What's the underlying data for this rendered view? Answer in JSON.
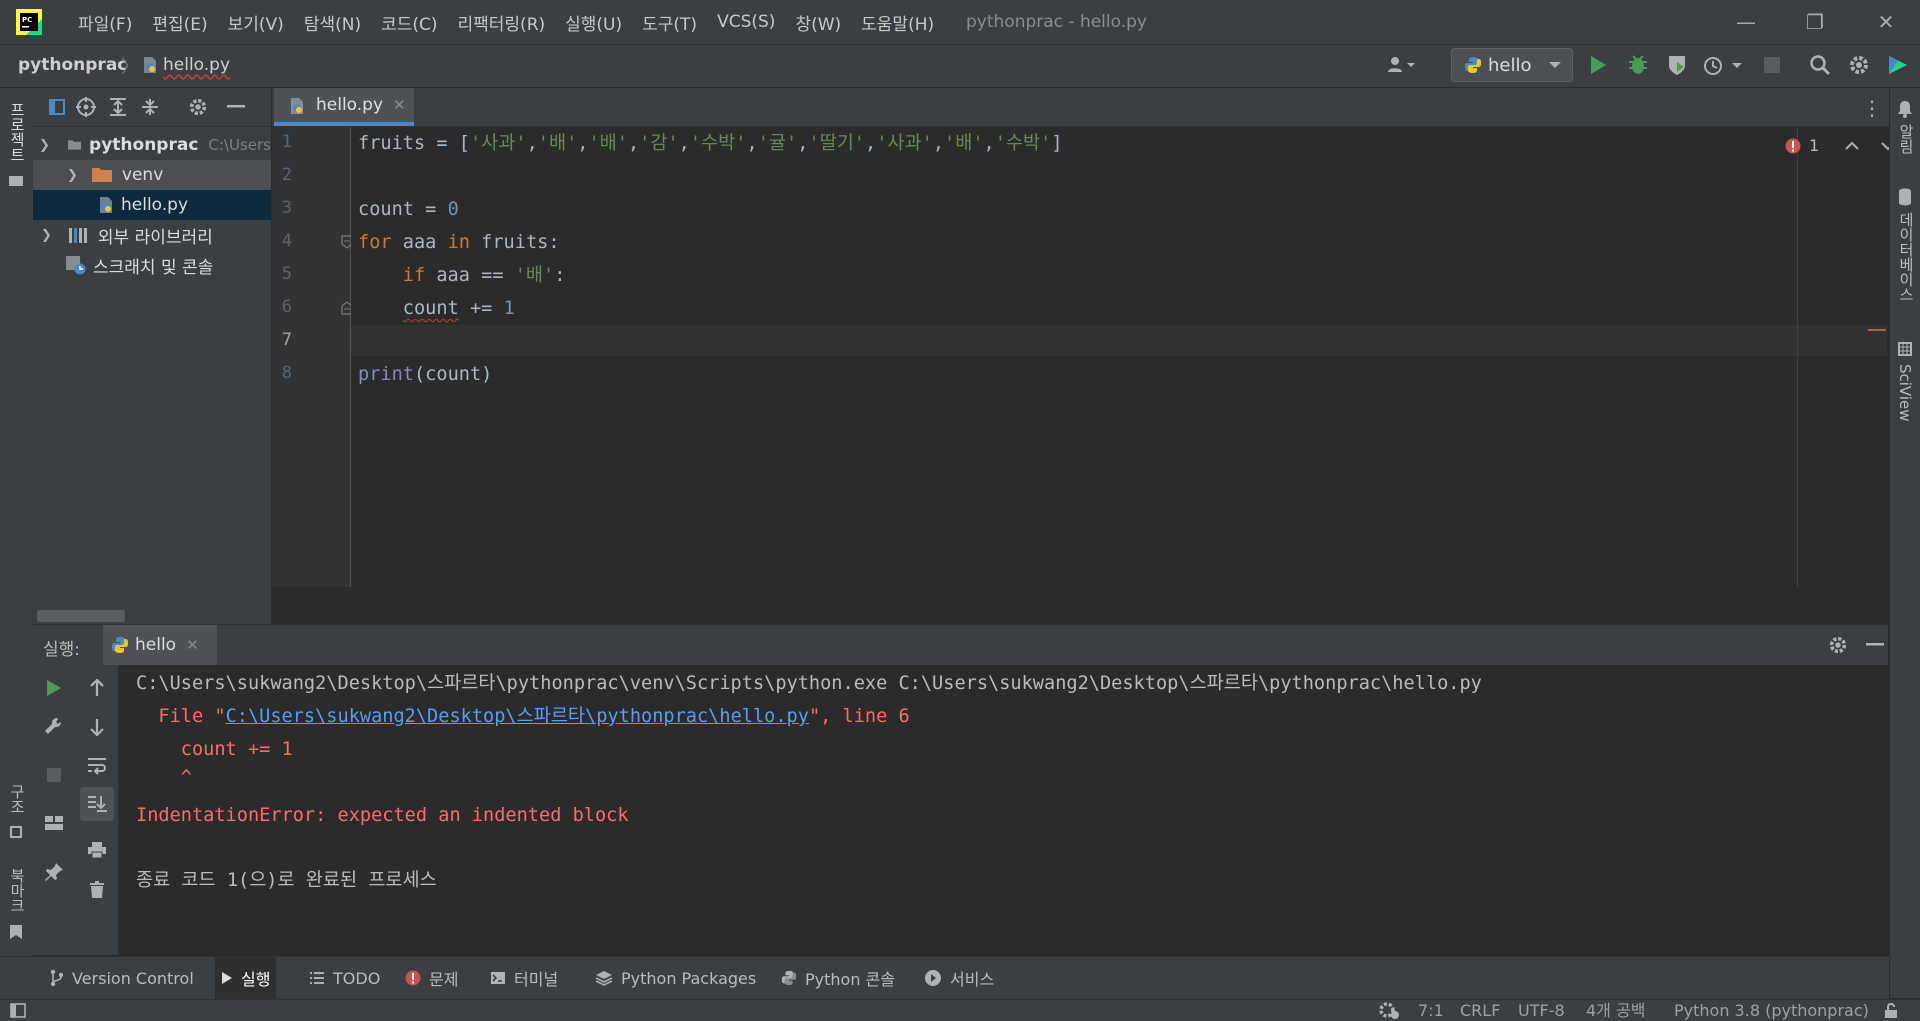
{
  "window": {
    "title": "pythonprac - hello.py",
    "minimize_symbol": "—",
    "restore_symbol": "❐",
    "close_symbol": "✕"
  },
  "menu": [
    "파일(F)",
    "편집(E)",
    "보기(V)",
    "탐색(N)",
    "코드(C)",
    "리팩터링(R)",
    "실행(U)",
    "도구(T)",
    "VCS(S)",
    "창(W)",
    "도움말(H)"
  ],
  "breadcrumb": {
    "project": "pythonprac",
    "file": "hello.py"
  },
  "run_config": {
    "label": "hello"
  },
  "left_stripe": {
    "project_label": "프로젝트",
    "structure_label": "구조",
    "bookmarks_label": "북마크"
  },
  "right_stripe": {
    "notifications_label": "알림",
    "database_label": "데이터베이스",
    "sciview_label": "SciView"
  },
  "project_tree": {
    "root": {
      "name": "pythonprac",
      "path": "C:\\Users"
    },
    "venv": "venv",
    "file": "hello.py",
    "external_libs": "외부 라이브러리",
    "scratches": "스크래치 및 콘솔"
  },
  "editor": {
    "tab": "hello.py",
    "line_numbers": [
      "1",
      "2",
      "3",
      "4",
      "5",
      "6",
      "7",
      "8"
    ],
    "problems_count": "1",
    "code": {
      "l1_var": "fruits",
      "l1_op": " = [",
      "l1_strings": [
        "'사과'",
        "'배'",
        "'배'",
        "'감'",
        "'수박'",
        "'귤'",
        "'딸기'",
        "'사과'",
        "'배'",
        "'수박'"
      ],
      "l1_close": "]",
      "l3_var": "count",
      "l3_op": " = ",
      "l3_num": "0",
      "l4_kw1": "for",
      "l4_mid": " aaa ",
      "l4_kw2": "in",
      "l4_end": " fruits:",
      "l5_indent": "    ",
      "l5_kw": "if",
      "l5_mid": " aaa == ",
      "l5_str": "'배'",
      "l5_end": ":",
      "l6_indent": "    ",
      "l6_var": "count",
      "l6_op": " += ",
      "l6_num": "1",
      "l8_fn": "print",
      "l8_args": "(count)"
    }
  },
  "run_panel": {
    "title": "실행:",
    "tab": "hello",
    "console": {
      "command": "C:\\Users\\sukwang2\\Desktop\\스파르타\\pythonprac\\venv\\Scripts\\python.exe C:\\Users\\sukwang2\\Desktop\\스파르타\\pythonprac\\hello.py",
      "file_prefix": "  File \"",
      "file_link": "C:\\Users\\sukwang2\\Desktop\\스파르타\\pythonprac\\hello.py",
      "file_suffix": "\", line 6",
      "code_line": "    count += 1",
      "caret_line": "    ^",
      "error": "IndentationError: expected an indented block",
      "exit": "종료 코드 1(으)로 완료된 프로세스"
    }
  },
  "bottom_tools": [
    {
      "label": "Version Control",
      "icon": "branch-icon"
    },
    {
      "label": "실행",
      "icon": "play-icon"
    },
    {
      "label": "TODO",
      "icon": "list-icon"
    },
    {
      "label": "문제",
      "icon": "error-icon"
    },
    {
      "label": "터미널",
      "icon": "terminal-icon"
    },
    {
      "label": "Python Packages",
      "icon": "packages-icon"
    },
    {
      "label": "Python 콘솔",
      "icon": "python-icon"
    },
    {
      "label": "서비스",
      "icon": "services-icon"
    }
  ],
  "status": {
    "position": "7:1",
    "line_sep": "CRLF",
    "encoding": "UTF-8",
    "indent": "4개 공백",
    "interpreter": "Python 3.8 (pythonprac)"
  },
  "colors": {
    "accent": "#4a88c7",
    "run_green": "#499c54",
    "error_red": "#ff6b68",
    "keyword": "#cc7832",
    "string": "#6a8759",
    "number": "#6897bb"
  }
}
